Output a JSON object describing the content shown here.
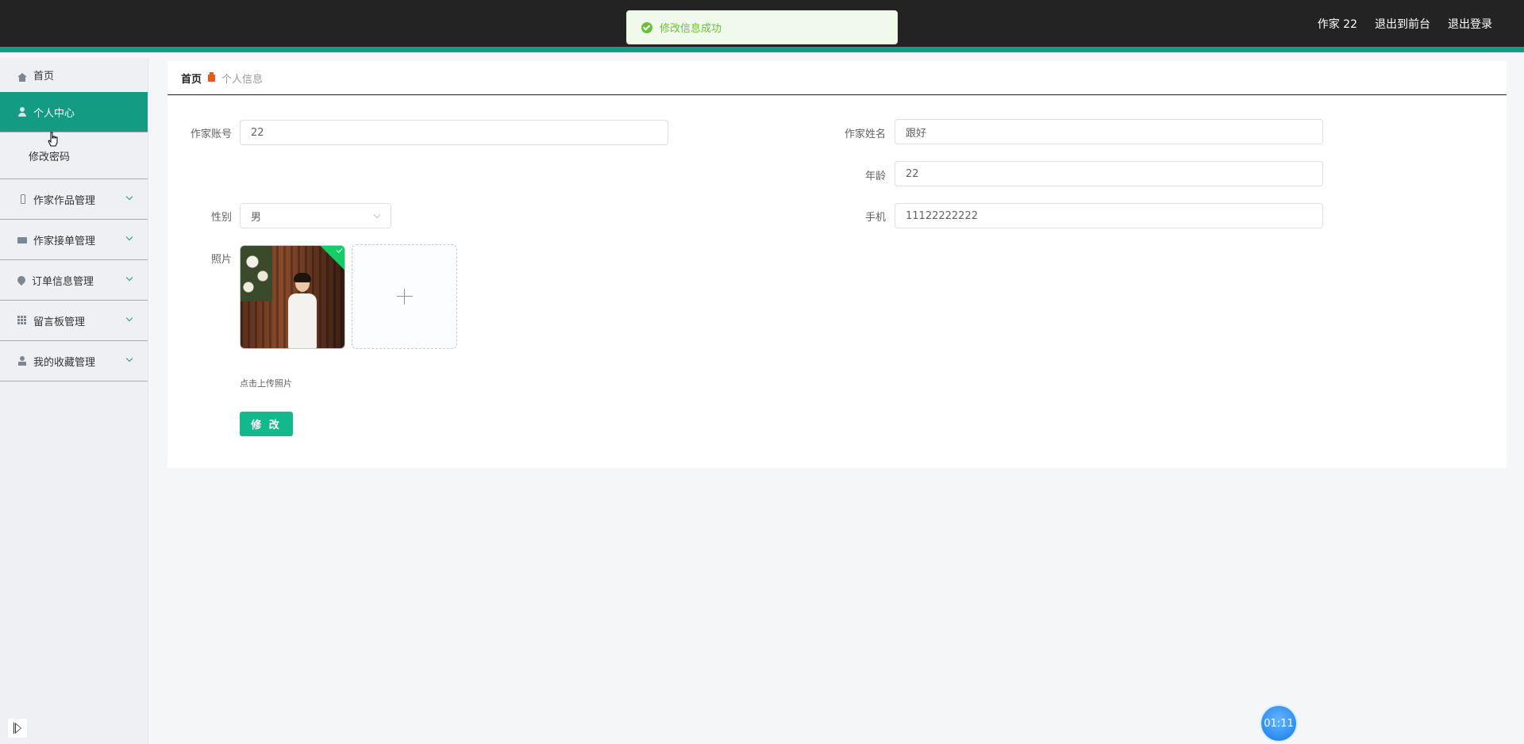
{
  "header": {
    "user_label": "作家 22",
    "front_link": "退出到前台",
    "logout_link": "退出登录"
  },
  "toast": {
    "message": "修改信息成功"
  },
  "sidebar": {
    "items": [
      {
        "label": "首页",
        "icon": "home-icon"
      },
      {
        "label": "个人中心",
        "icon": "user-icon",
        "active": true
      },
      {
        "label": "修改密码",
        "submenu": true
      },
      {
        "label": "作家作品管理",
        "icon": "pen-icon"
      },
      {
        "label": "作家接单管理",
        "icon": "chat-icon"
      },
      {
        "label": "订单信息管理",
        "icon": "pin-icon"
      },
      {
        "label": "留言板管理",
        "icon": "grid-icon"
      },
      {
        "label": "我的收藏管理",
        "icon": "person-icon"
      }
    ]
  },
  "breadcrumb": {
    "home": "首页",
    "current": "个人信息"
  },
  "form": {
    "account_label": "作家账号",
    "account_value": "22",
    "name_label": "作家姓名",
    "name_value": "跟好",
    "age_label": "年龄",
    "age_value": "22",
    "gender_label": "性别",
    "gender_value": "男",
    "phone_label": "手机",
    "phone_value": "11122222222",
    "photo_label": "照片",
    "upload_tip": "点击上传照片",
    "submit_label": "修 改"
  },
  "timer": {
    "value": "01:11"
  },
  "colors": {
    "accent": "#139b84",
    "topbar": "#232323",
    "success": "#67c23a",
    "button": "#13b98c"
  }
}
